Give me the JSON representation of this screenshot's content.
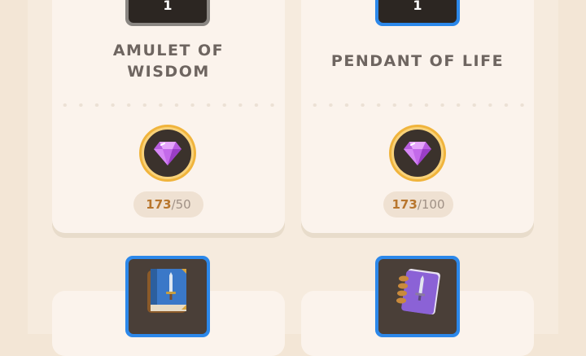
{
  "cards": [
    {
      "count": "1",
      "title_line1": "AMULET OF",
      "title_line2": "WISDOM",
      "gem_icon": "purple-gem-icon",
      "have": "173",
      "need": "/50",
      "frame_color": "#8a8682"
    },
    {
      "count": "1",
      "title_line1": "PENDANT OF LIFE",
      "gem_icon": "purple-gem-icon",
      "have": "173",
      "need": "/100",
      "frame_color": "#2c88ea"
    }
  ],
  "bottom_items": [
    {
      "icon": "blue-sword-book-icon"
    },
    {
      "icon": "purple-sword-book-icon"
    }
  ],
  "colors": {
    "background": "#f3e6d6",
    "card": "#fbf3ec",
    "gem": "#c86ae8",
    "gold_ring": "#f0b43c",
    "amount": "#b8762e"
  }
}
